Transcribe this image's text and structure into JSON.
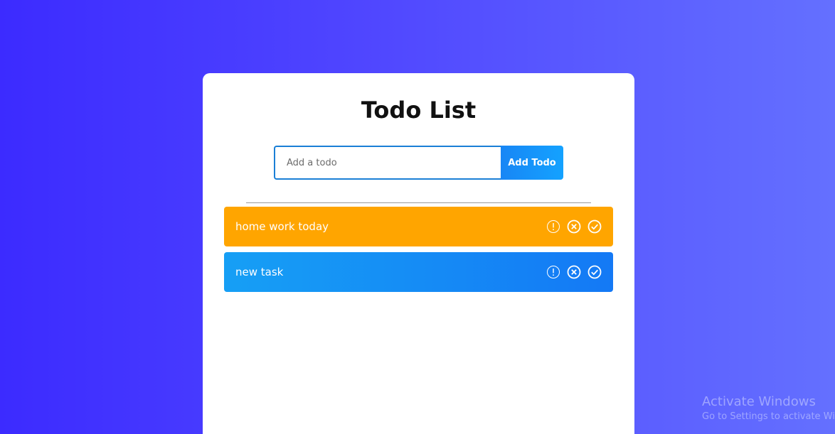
{
  "app": {
    "title": "Todo List"
  },
  "form": {
    "placeholder": "Add a todo",
    "value": "",
    "button_label": "Add Todo"
  },
  "todos": [
    {
      "text": "home work today",
      "color": "#ffa500"
    },
    {
      "text": "new task",
      "color": "#1479f5"
    }
  ],
  "item_icons": [
    "important-icon",
    "delete-icon",
    "complete-icon"
  ],
  "colors": {
    "accent": "#1886f5",
    "card": "#ffffff",
    "background": "#3c2bff"
  },
  "watermark": {
    "title": "Activate Windows",
    "subtitle": "Go to Settings to activate Windows."
  }
}
